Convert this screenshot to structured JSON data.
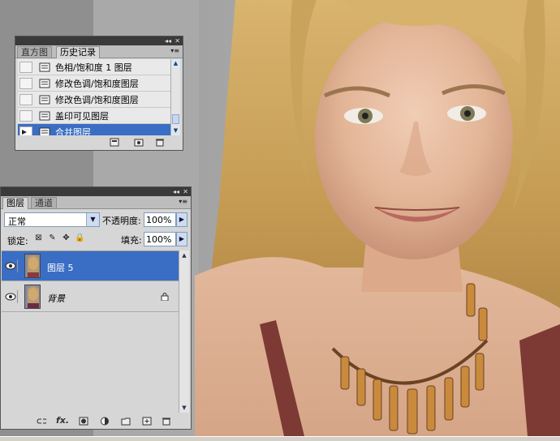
{
  "history_panel": {
    "tabs": [
      {
        "label": "直方图",
        "active": false
      },
      {
        "label": "历史记录",
        "active": true
      }
    ],
    "items": [
      {
        "label": "色相/饱和度 1 图层",
        "selected": false
      },
      {
        "label": "修改色调/饱和度图层",
        "selected": false
      },
      {
        "label": "修改色调/饱和度图层",
        "selected": false
      },
      {
        "label": "盖印可见图层",
        "selected": false
      },
      {
        "label": "合并图层",
        "selected": true
      }
    ],
    "footer_icons": [
      "new-document-from-state-icon",
      "new-snapshot-icon",
      "trash-icon"
    ]
  },
  "layers_panel": {
    "tabs": [
      {
        "label": "图层",
        "active": true
      },
      {
        "label": "通道",
        "active": false
      }
    ],
    "blend_mode": "正常",
    "opacity_label": "不透明度:",
    "opacity_value": "100%",
    "lock_label": "锁定:",
    "fill_label": "填充:",
    "fill_value": "100%",
    "layers": [
      {
        "name": "图层 5",
        "selected": true,
        "visible": true,
        "locked": false
      },
      {
        "name": "背景",
        "selected": false,
        "visible": true,
        "locked": true
      }
    ],
    "footer_icons": [
      "link-layers-icon",
      "fx-icon",
      "add-mask-icon",
      "adjustment-layer-icon",
      "new-group-icon",
      "new-layer-icon",
      "trash-icon"
    ]
  },
  "colors": {
    "selection": "#3a6ec4",
    "panel_bg": "#d6d6d6",
    "titlebar": "#3a3a3a"
  }
}
